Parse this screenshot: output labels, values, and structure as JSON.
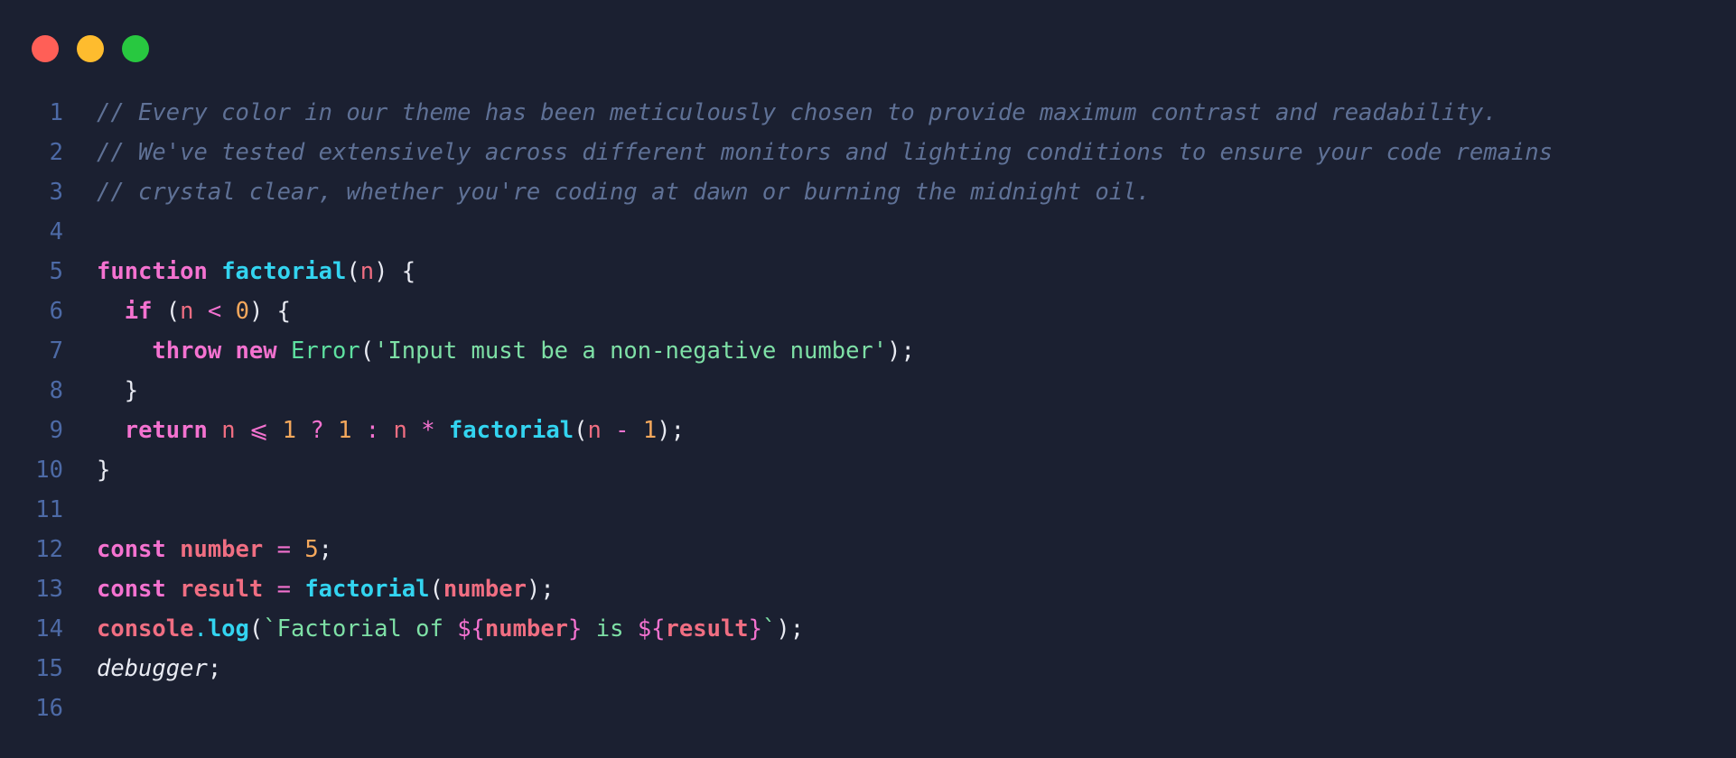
{
  "window": {
    "controls": [
      {
        "name": "close-button",
        "color": "#ff5f57"
      },
      {
        "name": "minimize-button",
        "color": "#febc2e"
      },
      {
        "name": "maximize-button",
        "color": "#28c840"
      }
    ]
  },
  "theme": {
    "background": "#1b2031",
    "line_number": "#4d6aa6",
    "comment": "#5f7196",
    "keyword": "#f472d0",
    "function": "#33d4f0",
    "variable": "#f06e82",
    "number": "#f5a85c",
    "string": "#7ee0a6",
    "class": "#5ee0a0",
    "punct": "#e8eaf2",
    "operator": "#f472d0"
  },
  "lines": [
    {
      "n": "1",
      "tokens": [
        {
          "t": "// Every color in our theme has been meticulously chosen to provide maximum contrast and readability.",
          "k": "comment"
        }
      ]
    },
    {
      "n": "2",
      "tokens": [
        {
          "t": "// We've tested extensively across different monitors and lighting conditions to ensure your code remains",
          "k": "comment"
        }
      ]
    },
    {
      "n": "3",
      "tokens": [
        {
          "t": "// crystal clear, whether you're coding at dawn or burning the midnight oil.",
          "k": "comment"
        }
      ]
    },
    {
      "n": "4",
      "tokens": []
    },
    {
      "n": "5",
      "tokens": [
        {
          "t": "function",
          "k": "keyword",
          "b": true
        },
        {
          "t": " ",
          "k": "punct"
        },
        {
          "t": "factorial",
          "k": "function",
          "b": true
        },
        {
          "t": "(",
          "k": "punct"
        },
        {
          "t": "n",
          "k": "variable"
        },
        {
          "t": ") {",
          "k": "punct"
        }
      ]
    },
    {
      "n": "6",
      "tokens": [
        {
          "t": "  ",
          "k": "punct"
        },
        {
          "t": "if",
          "k": "keyword",
          "b": true
        },
        {
          "t": " (",
          "k": "punct"
        },
        {
          "t": "n",
          "k": "variable"
        },
        {
          "t": " < ",
          "k": "operator"
        },
        {
          "t": "0",
          "k": "number"
        },
        {
          "t": ") {",
          "k": "punct"
        }
      ]
    },
    {
      "n": "7",
      "tokens": [
        {
          "t": "    ",
          "k": "punct"
        },
        {
          "t": "throw",
          "k": "keyword",
          "b": true
        },
        {
          "t": " ",
          "k": "punct"
        },
        {
          "t": "new",
          "k": "keyword",
          "b": true
        },
        {
          "t": " ",
          "k": "punct"
        },
        {
          "t": "Error",
          "k": "class"
        },
        {
          "t": "(",
          "k": "punct"
        },
        {
          "t": "'Input must be a non-negative number'",
          "k": "string"
        },
        {
          "t": ");",
          "k": "punct"
        }
      ]
    },
    {
      "n": "8",
      "tokens": [
        {
          "t": "  }",
          "k": "punct"
        }
      ]
    },
    {
      "n": "9",
      "tokens": [
        {
          "t": "  ",
          "k": "punct"
        },
        {
          "t": "return",
          "k": "keyword",
          "b": true
        },
        {
          "t": " ",
          "k": "punct"
        },
        {
          "t": "n",
          "k": "variable"
        },
        {
          "t": " ⩽ ",
          "k": "operator"
        },
        {
          "t": "1",
          "k": "number"
        },
        {
          "t": " ? ",
          "k": "operator"
        },
        {
          "t": "1",
          "k": "number"
        },
        {
          "t": " : ",
          "k": "operator"
        },
        {
          "t": "n",
          "k": "variable"
        },
        {
          "t": " * ",
          "k": "operator"
        },
        {
          "t": "factorial",
          "k": "function",
          "b": true
        },
        {
          "t": "(",
          "k": "punct"
        },
        {
          "t": "n",
          "k": "variable"
        },
        {
          "t": " - ",
          "k": "operator"
        },
        {
          "t": "1",
          "k": "number"
        },
        {
          "t": ");",
          "k": "punct"
        }
      ]
    },
    {
      "n": "10",
      "tokens": [
        {
          "t": "}",
          "k": "punct"
        }
      ]
    },
    {
      "n": "11",
      "tokens": []
    },
    {
      "n": "12",
      "tokens": [
        {
          "t": "const",
          "k": "keyword",
          "b": true
        },
        {
          "t": " ",
          "k": "punct"
        },
        {
          "t": "number",
          "k": "variable",
          "b": true
        },
        {
          "t": " = ",
          "k": "operator"
        },
        {
          "t": "5",
          "k": "number"
        },
        {
          "t": ";",
          "k": "punct"
        }
      ]
    },
    {
      "n": "13",
      "tokens": [
        {
          "t": "const",
          "k": "keyword",
          "b": true
        },
        {
          "t": " ",
          "k": "punct"
        },
        {
          "t": "result",
          "k": "variable",
          "b": true
        },
        {
          "t": " = ",
          "k": "operator"
        },
        {
          "t": "factorial",
          "k": "function",
          "b": true
        },
        {
          "t": "(",
          "k": "punct"
        },
        {
          "t": "number",
          "k": "variable",
          "b": true
        },
        {
          "t": ");",
          "k": "punct"
        }
      ]
    },
    {
      "n": "14",
      "tokens": [
        {
          "t": "console",
          "k": "variable",
          "b": true
        },
        {
          "t": ".",
          "k": "function"
        },
        {
          "t": "log",
          "k": "function",
          "b": true
        },
        {
          "t": "(",
          "k": "punct"
        },
        {
          "t": "`Factorial of ",
          "k": "string"
        },
        {
          "t": "${",
          "k": "keyword"
        },
        {
          "t": "number",
          "k": "variable",
          "b": true
        },
        {
          "t": "}",
          "k": "keyword"
        },
        {
          "t": " is ",
          "k": "string"
        },
        {
          "t": "${",
          "k": "keyword"
        },
        {
          "t": "result",
          "k": "variable",
          "b": true
        },
        {
          "t": "}",
          "k": "keyword"
        },
        {
          "t": "`",
          "k": "string"
        },
        {
          "t": ");",
          "k": "punct"
        }
      ]
    },
    {
      "n": "15",
      "tokens": [
        {
          "t": "debugger",
          "k": "punct",
          "i": true
        },
        {
          "t": ";",
          "k": "punct"
        }
      ]
    },
    {
      "n": "16",
      "tokens": []
    }
  ]
}
